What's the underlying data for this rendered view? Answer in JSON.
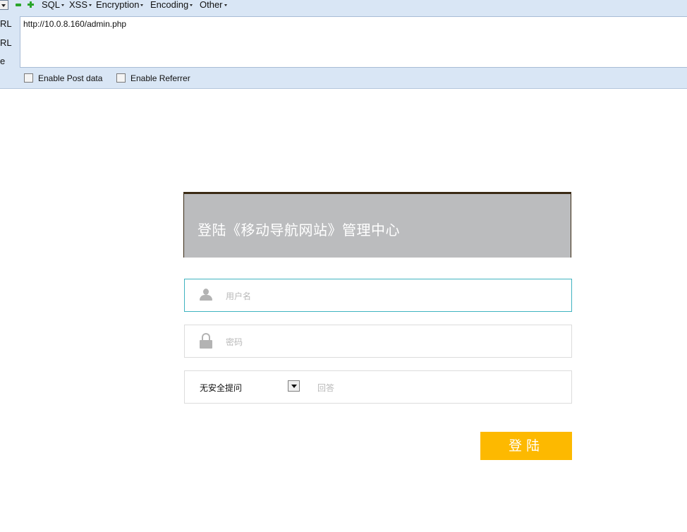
{
  "hackbar": {
    "menus": [
      {
        "label": "SQL"
      },
      {
        "label": "XSS"
      },
      {
        "label": "Encryption"
      },
      {
        "label": "Encoding"
      },
      {
        "label": "Other"
      }
    ],
    "side_labels": [
      "RL",
      "RL",
      "e"
    ],
    "url": "http://10.0.8.160/admin.php",
    "options": {
      "post_data": "Enable Post data",
      "referrer": "Enable Referrer"
    }
  },
  "login": {
    "title": "登陆《移动导航网站》管理中心",
    "username_placeholder": "用户名",
    "password_placeholder": "密码",
    "question_selected": "无安全提问",
    "answer_placeholder": "回答",
    "submit_label": "登陆"
  },
  "colors": {
    "header_bg": "#bbbcbe",
    "submit_bg": "#fdb900",
    "active_border": "#3fb3c0",
    "toolbar_bg": "#d9e6f5"
  }
}
